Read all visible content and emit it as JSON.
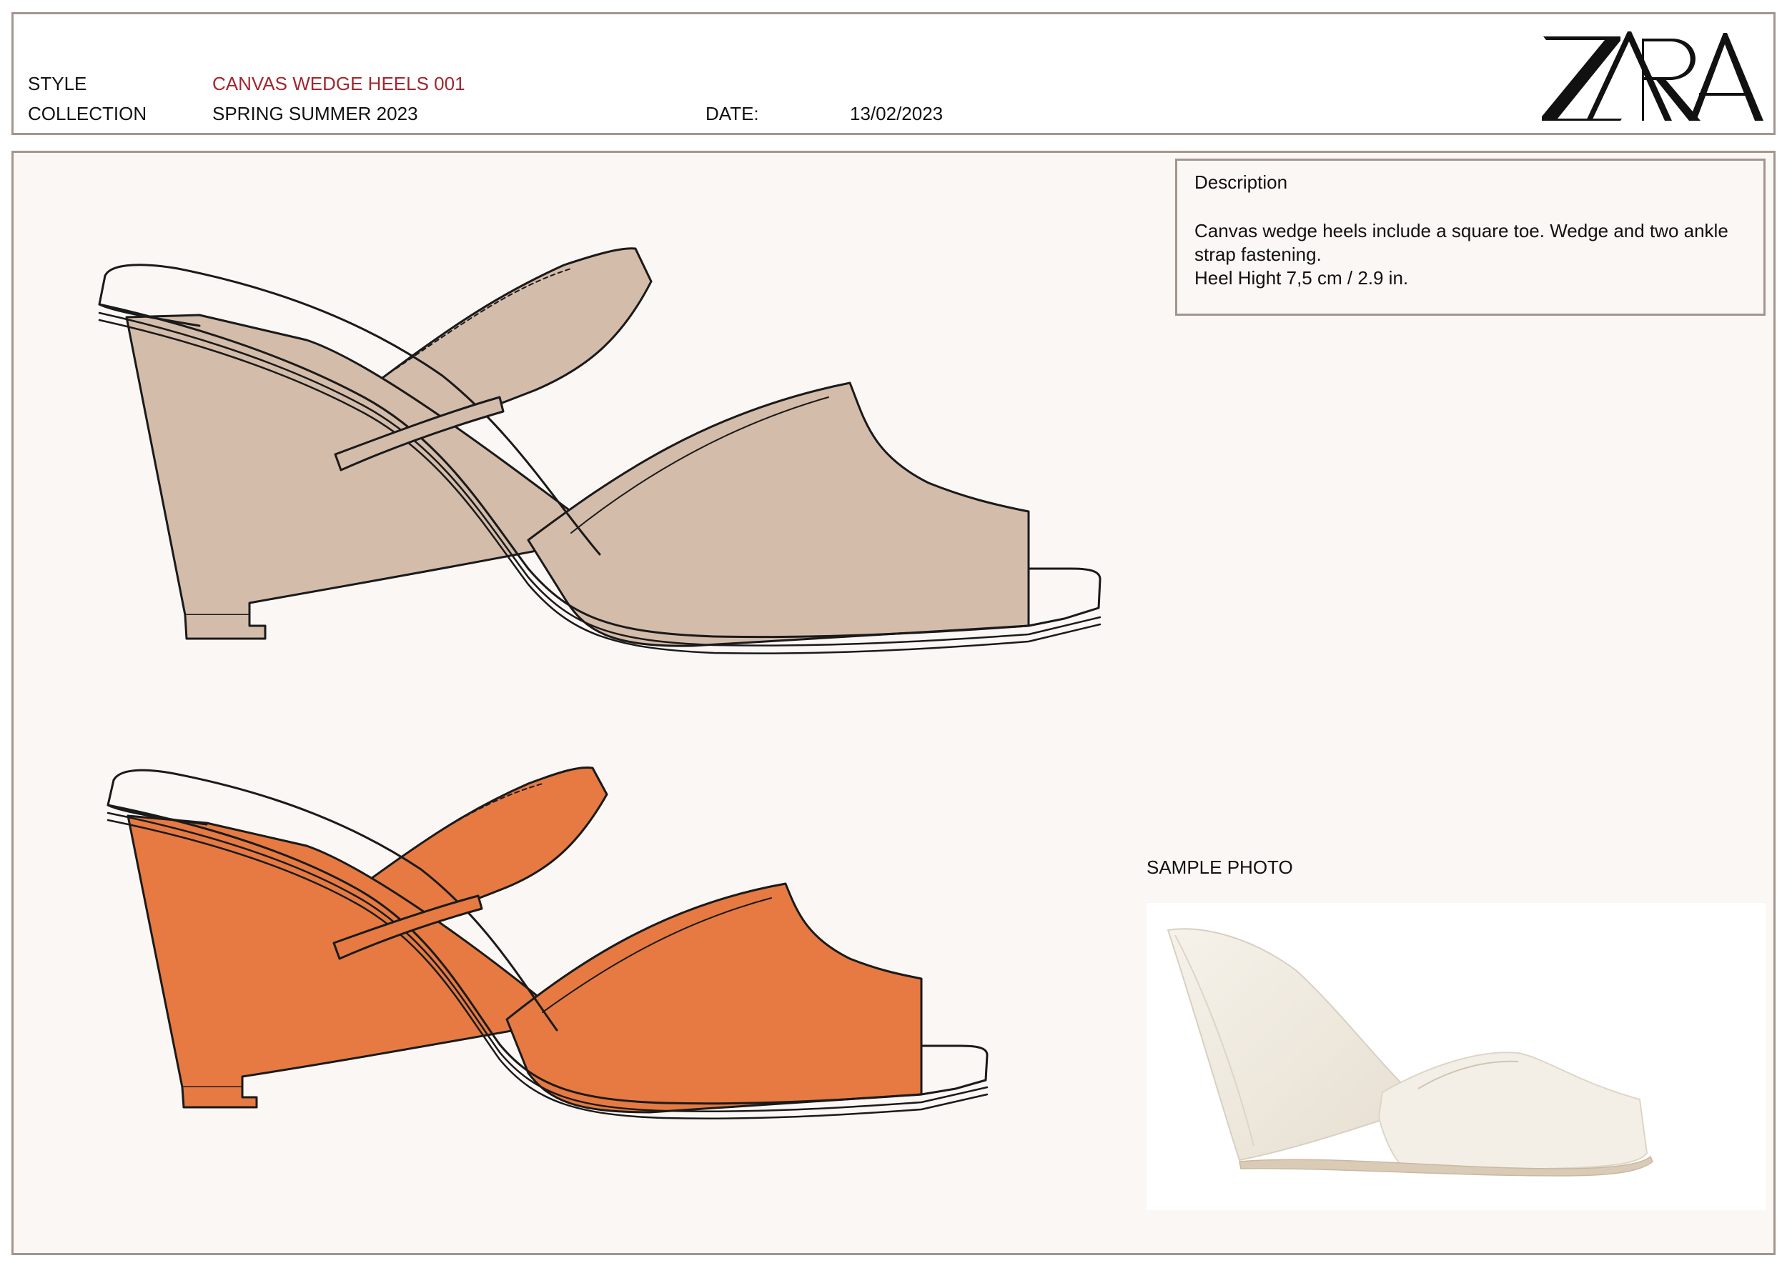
{
  "header": {
    "style_label": "STYLE",
    "style_value": "CANVAS WEDGE HEELS 001",
    "collection_label": "COLLECTION",
    "collection_value": "SPRING SUMMER 2023",
    "date_label": "DATE:",
    "date_value": "13/02/2023",
    "logo_text": "ZARA"
  },
  "description": {
    "title": "Description",
    "line1": "Canvas wedge heels include a square toe. Wedge and two ankle strap fastening.",
    "line2": "Heel Hight 7,5 cm / 2.9 in."
  },
  "sample": {
    "title": "SAMPLE PHOTO"
  },
  "colors": {
    "accent": "#a3262f",
    "border": "#a2968e",
    "beige": "#d4bcab",
    "orange": "#e67a42",
    "sample_cream": "#f2ede2",
    "background": "#faf7f4"
  },
  "sketches": [
    "beige-colorway",
    "orange-colorway"
  ]
}
